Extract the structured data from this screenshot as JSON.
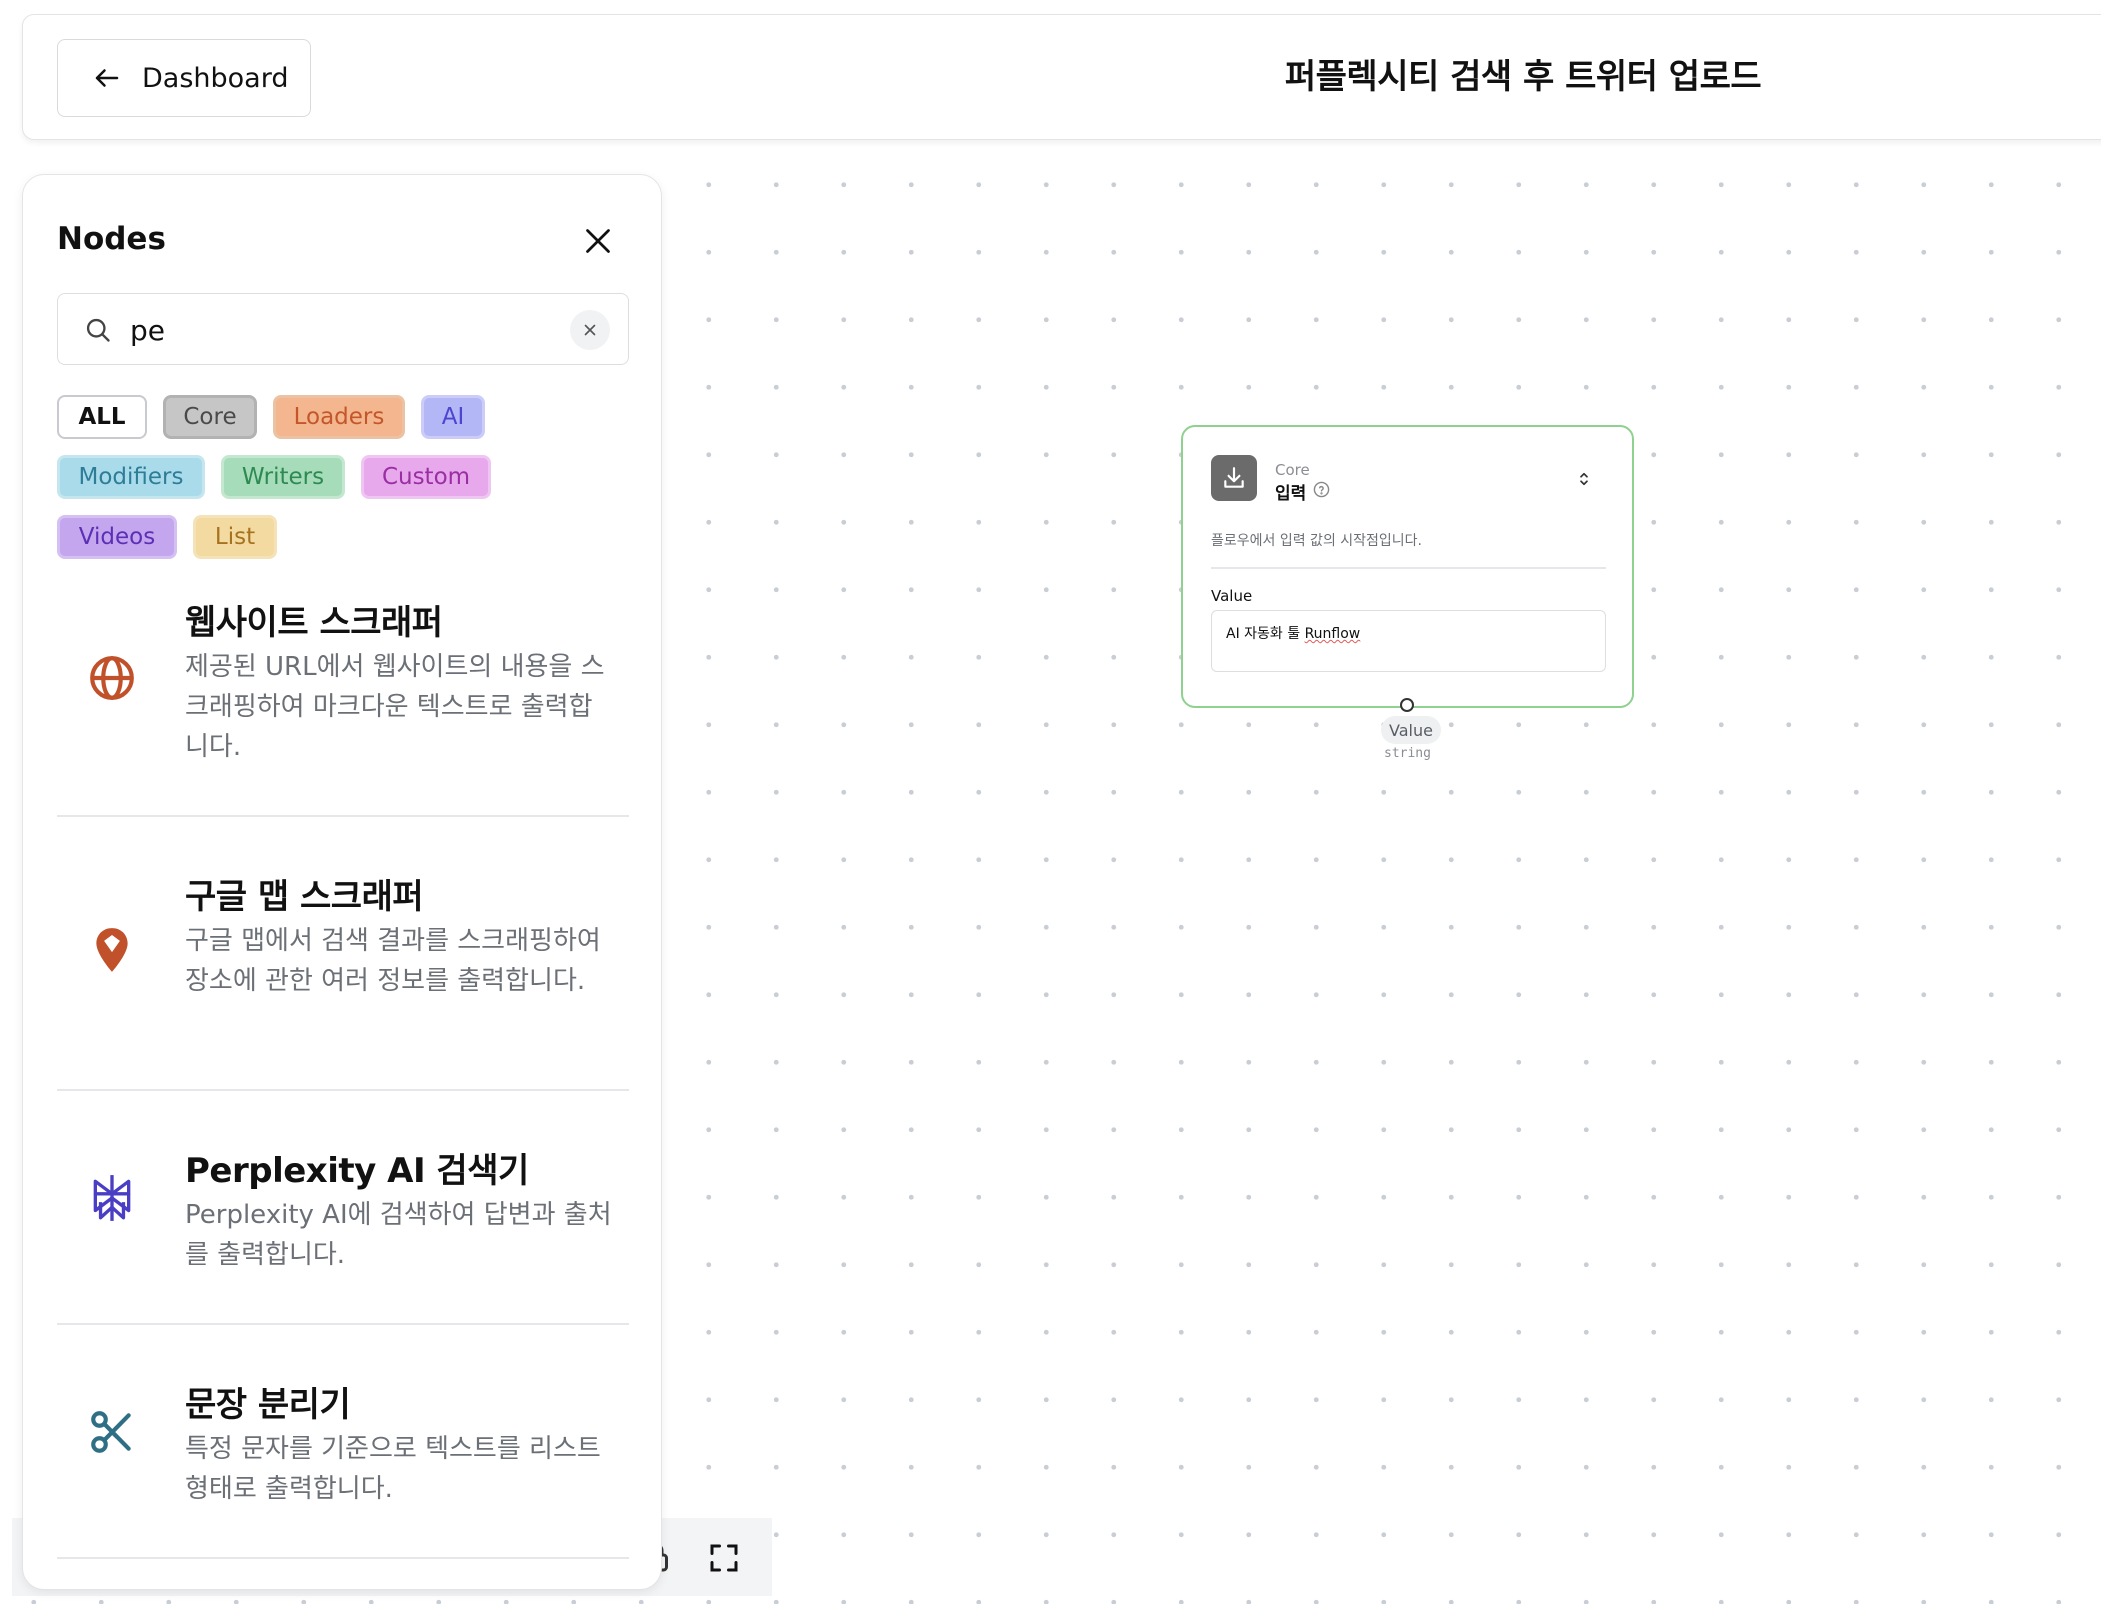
{
  "header": {
    "back_label": "Dashboard",
    "flow_title": "퍼플렉시티 검색 후 트위터 업로드"
  },
  "panel": {
    "title": "Nodes",
    "search": {
      "value": "pe",
      "placeholder": ""
    },
    "filters": [
      {
        "label": "ALL"
      },
      {
        "label": "Core"
      },
      {
        "label": "Loaders"
      },
      {
        "label": "AI"
      },
      {
        "label": "Modifiers"
      },
      {
        "label": "Writers"
      },
      {
        "label": "Custom"
      },
      {
        "label": "Videos"
      },
      {
        "label": "List"
      }
    ],
    "items": [
      {
        "title": "웹사이트 스크래퍼",
        "desc": "제공된 URL에서 웹사이트의 내용을 스크래핑하여 마크다운 텍스트로 출력합니다.",
        "icon": "globe-icon"
      },
      {
        "title": "구글 맵 스크래퍼",
        "desc": "구글 맵에서 검색 결과를 스크래핑하여 장소에 관한 여러 정보를 출력합니다.",
        "icon": "map-pin-icon"
      },
      {
        "title": "Perplexity AI 검색기",
        "desc": "Perplexity AI에 검색하여 답변과 출처를 출력합니다.",
        "icon": "perplexity-icon"
      },
      {
        "title": "문장 분리기",
        "desc": "특정 문자를 기준으로 텍스트를 리스트 형태로 출력합니다.",
        "icon": "scissors-icon"
      }
    ]
  },
  "node": {
    "category": "Core",
    "name": "입력",
    "description": "플로우에서 입력 값의 시작점입니다.",
    "field_label": "Value",
    "field_value_prefix": "AI 자동화 툴 ",
    "field_value_marked": "Runflow",
    "output_label": "Value",
    "output_type": "string"
  },
  "colors": {
    "node_border": "#8fd18f",
    "globe": "#c0512a",
    "map_pin": "#c0512a",
    "perplexity": "#4a3fc4",
    "scissors": "#2f6f86"
  }
}
